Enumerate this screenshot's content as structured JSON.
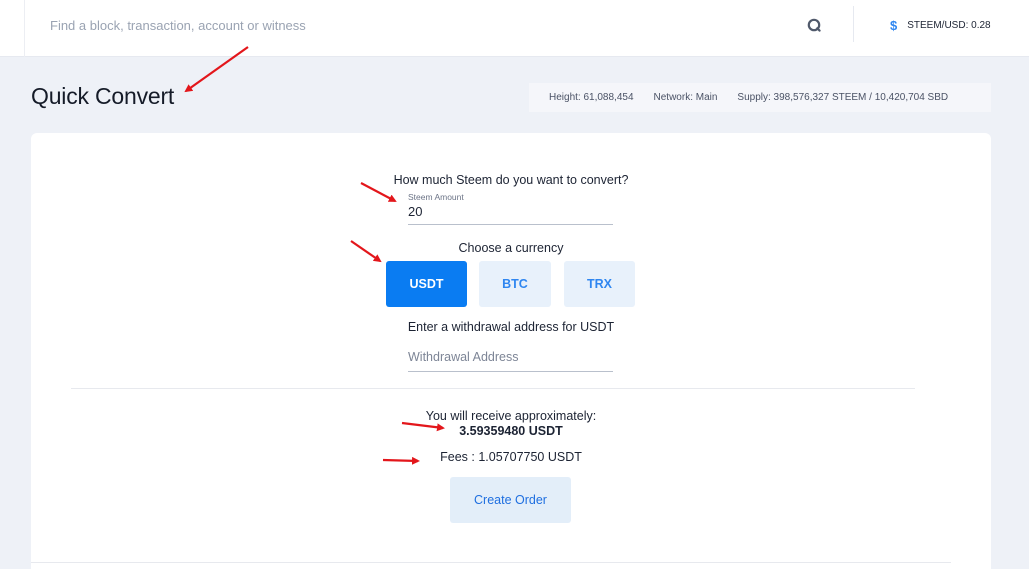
{
  "header": {
    "search_placeholder": "Find a block, transaction, account or witness",
    "price_symbol": "$",
    "price_label": "STEEM/USD: 0.28"
  },
  "page": {
    "title": "Quick Convert"
  },
  "stats": {
    "height": "Height: 61,088,454",
    "network": "Network: Main",
    "supply": "Supply: 398,576,327 STEEM / 10,420,704 SBD"
  },
  "form": {
    "question": "How much Steem do you want to convert?",
    "amount_label": "Steem Amount",
    "amount_value": "20",
    "currency_label": "Choose a currency",
    "currencies": [
      "USDT",
      "BTC",
      "TRX"
    ],
    "selected_currency": "USDT",
    "address_label": "Enter a withdrawal address for USDT",
    "address_placeholder": "Withdrawal Address",
    "receive_label": "You will receive approximately:",
    "receive_value": "3.59359480 USDT",
    "fees": "Fees : 1.05707750 USDT",
    "create_order_label": "Create Order"
  },
  "colors": {
    "accent": "#0a7cf2",
    "annotation_arrow": "#e3161b"
  }
}
